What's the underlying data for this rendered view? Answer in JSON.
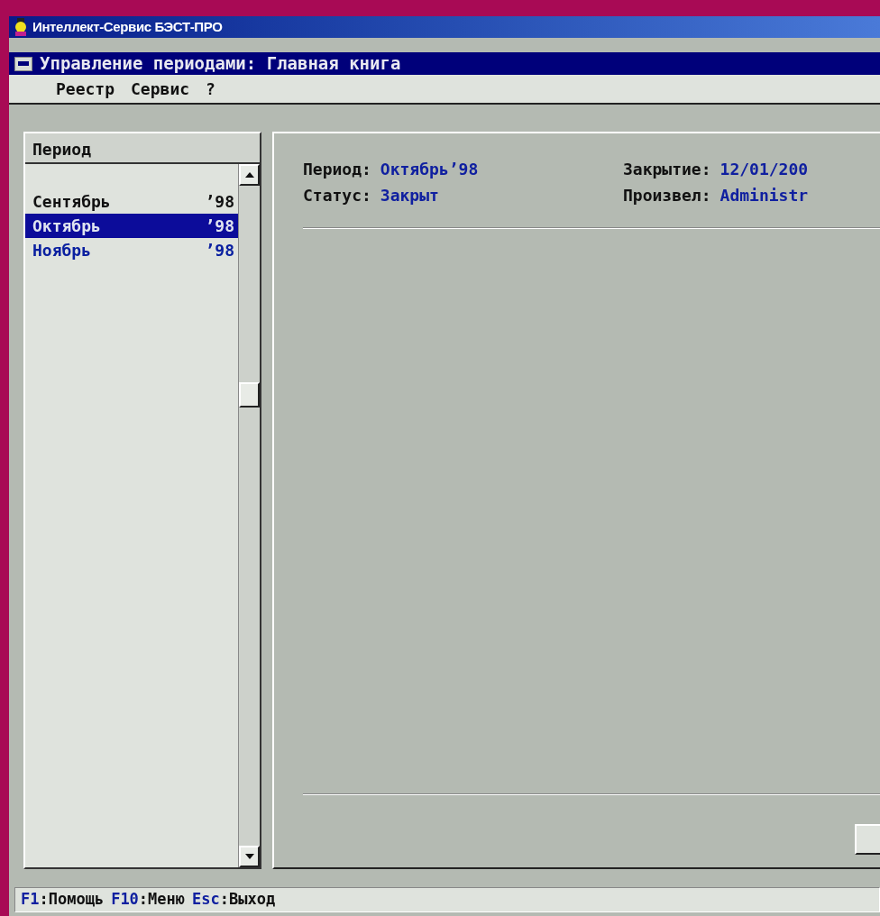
{
  "app_title": "Интеллект-Сервис БЭСТ-ПРО",
  "window": {
    "title": "Управление периодами: Главная книга"
  },
  "menu": [
    "Реестр",
    "Сервис",
    "?"
  ],
  "period_list": {
    "header": "Период",
    "items": [
      {
        "month": "Сентябрь",
        "year": "’98",
        "selected": false,
        "closed": false
      },
      {
        "month": "Октябрь",
        "year": "’98",
        "selected": true,
        "closed": true
      },
      {
        "month": "Ноябрь",
        "year": "’98",
        "selected": false,
        "closed": true
      }
    ]
  },
  "details": [
    {
      "label": "Период:",
      "value": "Октябрь’98"
    },
    {
      "label": "Закрытие:",
      "value": "12/01/200"
    },
    {
      "label": "Статус:",
      "value": "Закрыт"
    },
    {
      "label": "Произвел:",
      "value": "Administr"
    }
  ],
  "status_bar": [
    {
      "key": "F1",
      "label": ":Помощь"
    },
    {
      "key": "F10",
      "label": ":Меню"
    },
    {
      "key": "Esc",
      "label": ":Выход"
    }
  ]
}
